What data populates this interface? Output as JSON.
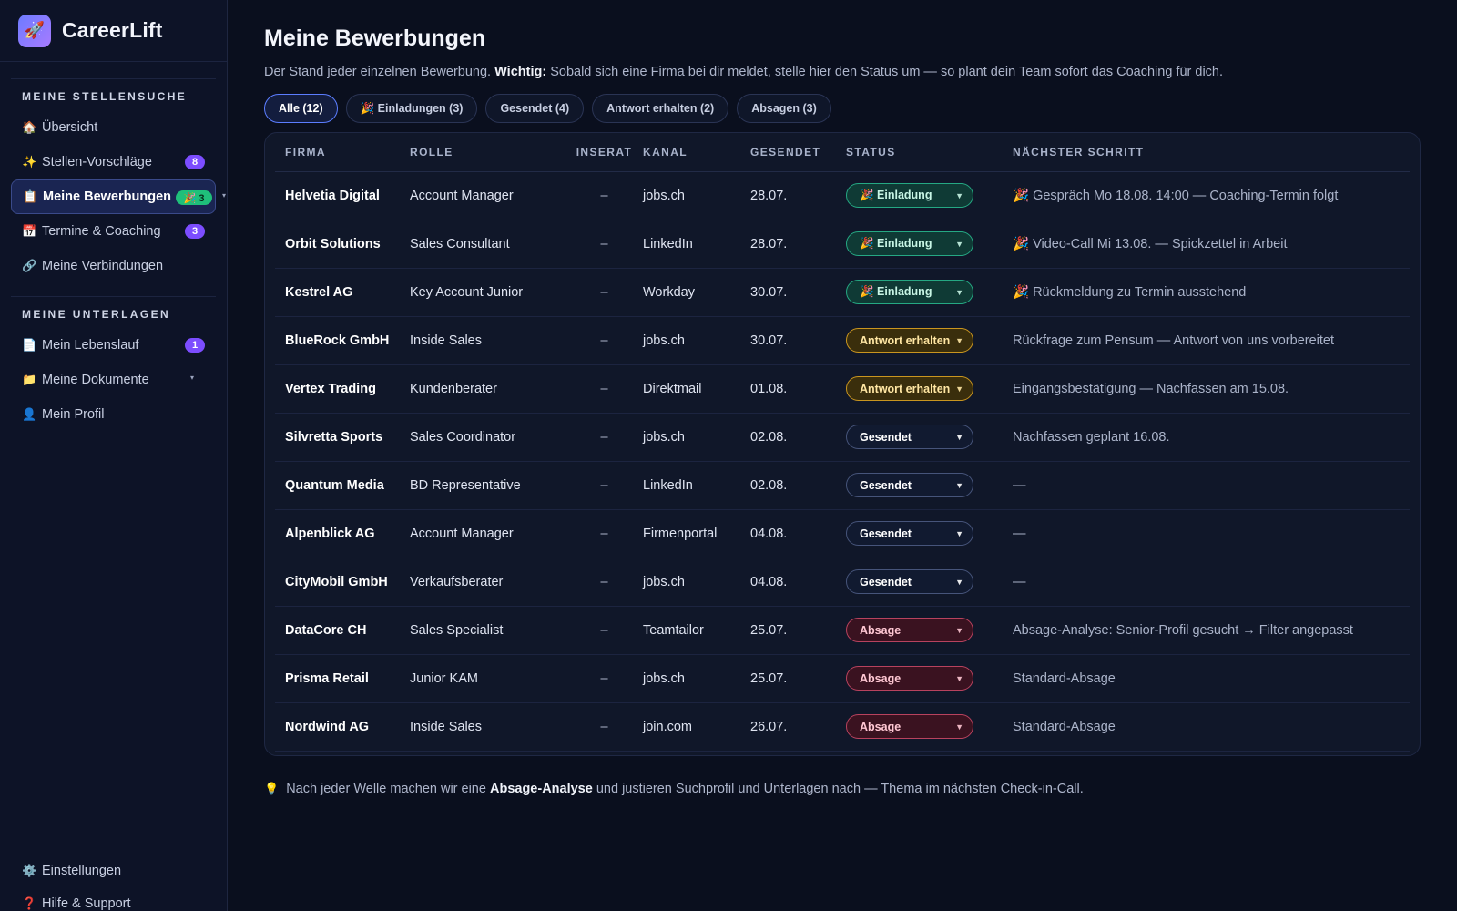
{
  "brand": {
    "logo_glyph": "🚀",
    "name": "CareerLift"
  },
  "sidebar": {
    "sections": [
      {
        "heading": "MEINE STELLENSUCHE",
        "items": [
          {
            "icon": "🏠",
            "label": "Übersicht"
          },
          {
            "icon": "✨",
            "label": "Stellen-Vorschläge",
            "badge": "8"
          },
          {
            "icon": "📋",
            "label": "Meine Bewerbungen",
            "badge": "🎉 3",
            "active": true
          },
          {
            "icon": "📅",
            "label": "Termine & Coaching",
            "badge": "3"
          },
          {
            "icon": "🔗",
            "label": "Meine Verbindungen"
          }
        ]
      },
      {
        "heading": "MEINE UNTERLAGEN",
        "items": [
          {
            "icon": "📄",
            "label": "Mein Lebenslauf",
            "badge": "1"
          },
          {
            "icon": "📁",
            "label": "Meine Dokumente"
          },
          {
            "icon": "👤",
            "label": "Mein Profil"
          }
        ]
      }
    ],
    "bottom": [
      {
        "icon": "⚙️",
        "label": "Einstellungen"
      },
      {
        "icon": "❓",
        "label": "Hilfe & Support"
      }
    ]
  },
  "page": {
    "title": "Meine Bewerbungen",
    "desc_lead": "Der Stand jeder einzelnen Bewerbung.",
    "desc_strong": "Wichtig:",
    "desc_rest": "Sobald sich eine Firma bei dir meldet, stelle hier den Status um — so plant dein Team sofort das Coaching für dich."
  },
  "filters": [
    {
      "label": "Alle (12)",
      "active": true
    },
    {
      "label": "🎉 Einladungen (3)"
    },
    {
      "label": "Gesendet (4)"
    },
    {
      "label": "Antwort erhalten (2)"
    },
    {
      "label": "Absagen (3)"
    }
  ],
  "table": {
    "headers": [
      "FIRMA",
      "ROLLE",
      "INSERAT",
      "KANAL",
      "GESENDET",
      "STATUS",
      "NÄCHSTER SCHRITT"
    ],
    "rows": [
      {
        "firma": "Helvetia Digital",
        "rolle": "Account Manager",
        "inserat": "–",
        "kanal": "jobs.ch",
        "gesendet": "28.07.",
        "status": "🎉 Einladung",
        "status_kind": "invite",
        "next": "🎉 Gespräch Mo 18.08. 14:00 — Coaching-Termin folgt"
      },
      {
        "firma": "Orbit Solutions",
        "rolle": "Sales Consultant",
        "inserat": "–",
        "kanal": "LinkedIn",
        "gesendet": "28.07.",
        "status": "🎉 Einladung",
        "status_kind": "invite",
        "next": "🎉 Video-Call Mi 13.08. — Spickzettel in Arbeit"
      },
      {
        "firma": "Kestrel AG",
        "rolle": "Key Account Junior",
        "inserat": "–",
        "kanal": "Workday",
        "gesendet": "30.07.",
        "status": "🎉 Einladung",
        "status_kind": "invite",
        "next": "🎉 Rückmeldung zu Termin ausstehend"
      },
      {
        "firma": "BlueRock GmbH",
        "rolle": "Inside Sales",
        "inserat": "–",
        "kanal": "jobs.ch",
        "gesendet": "30.07.",
        "status": "Antwort erhalten",
        "status_kind": "reply",
        "next": "Rückfrage zum Pensum — Antwort von uns vorbereitet"
      },
      {
        "firma": "Vertex Trading",
        "rolle": "Kundenberater",
        "inserat": "–",
        "kanal": "Direktmail",
        "gesendet": "01.08.",
        "status": "Antwort erhalten",
        "status_kind": "reply",
        "next": "Eingangsbestätigung — Nachfassen am 15.08."
      },
      {
        "firma": "Silvretta Sports",
        "rolle": "Sales Coordinator",
        "inserat": "–",
        "kanal": "jobs.ch",
        "gesendet": "02.08.",
        "status": "Gesendet",
        "status_kind": "sent",
        "next": "Nachfassen geplant 16.08."
      },
      {
        "firma": "Quantum Media",
        "rolle": "BD Representative",
        "inserat": "–",
        "kanal": "LinkedIn",
        "gesendet": "02.08.",
        "status": "Gesendet",
        "status_kind": "sent",
        "next": "—"
      },
      {
        "firma": "Alpenblick AG",
        "rolle": "Account Manager",
        "inserat": "–",
        "kanal": "Firmenportal",
        "gesendet": "04.08.",
        "status": "Gesendet",
        "status_kind": "sent",
        "next": "—"
      },
      {
        "firma": "CityMobil GmbH",
        "rolle": "Verkaufsberater",
        "inserat": "–",
        "kanal": "jobs.ch",
        "gesendet": "04.08.",
        "status": "Gesendet",
        "status_kind": "sent",
        "next": "—"
      },
      {
        "firma": "DataCore CH",
        "rolle": "Sales Specialist",
        "inserat": "–",
        "kanal": "Teamtailor",
        "gesendet": "25.07.",
        "status": "Absage",
        "status_kind": "reject",
        "next": "Absage-Analyse: Senior-Profil gesucht → Filter angepasst"
      },
      {
        "firma": "Prisma Retail",
        "rolle": "Junior KAM",
        "inserat": "–",
        "kanal": "jobs.ch",
        "gesendet": "25.07.",
        "status": "Absage",
        "status_kind": "reject",
        "next": "Standard-Absage"
      },
      {
        "firma": "Nordwind AG",
        "rolle": "Inside Sales",
        "inserat": "–",
        "kanal": "join.com",
        "gesendet": "26.07.",
        "status": "Absage",
        "status_kind": "reject",
        "next": "Standard-Absage"
      }
    ]
  },
  "footnote": {
    "icon": "💡",
    "lead": "Nach jeder Welle machen wir eine",
    "strong": "Absage-Analyse",
    "rest": "und justieren Suchprofil und Unterlagen nach — Thema im nächsten Check-in-Call."
  },
  "colors": {
    "background": "#0a0f1e",
    "accent": "#5b7dff",
    "badge_purple": "#7c4dff",
    "invite": "#25a883",
    "reply": "#c9951f",
    "reject": "#b8425e"
  }
}
